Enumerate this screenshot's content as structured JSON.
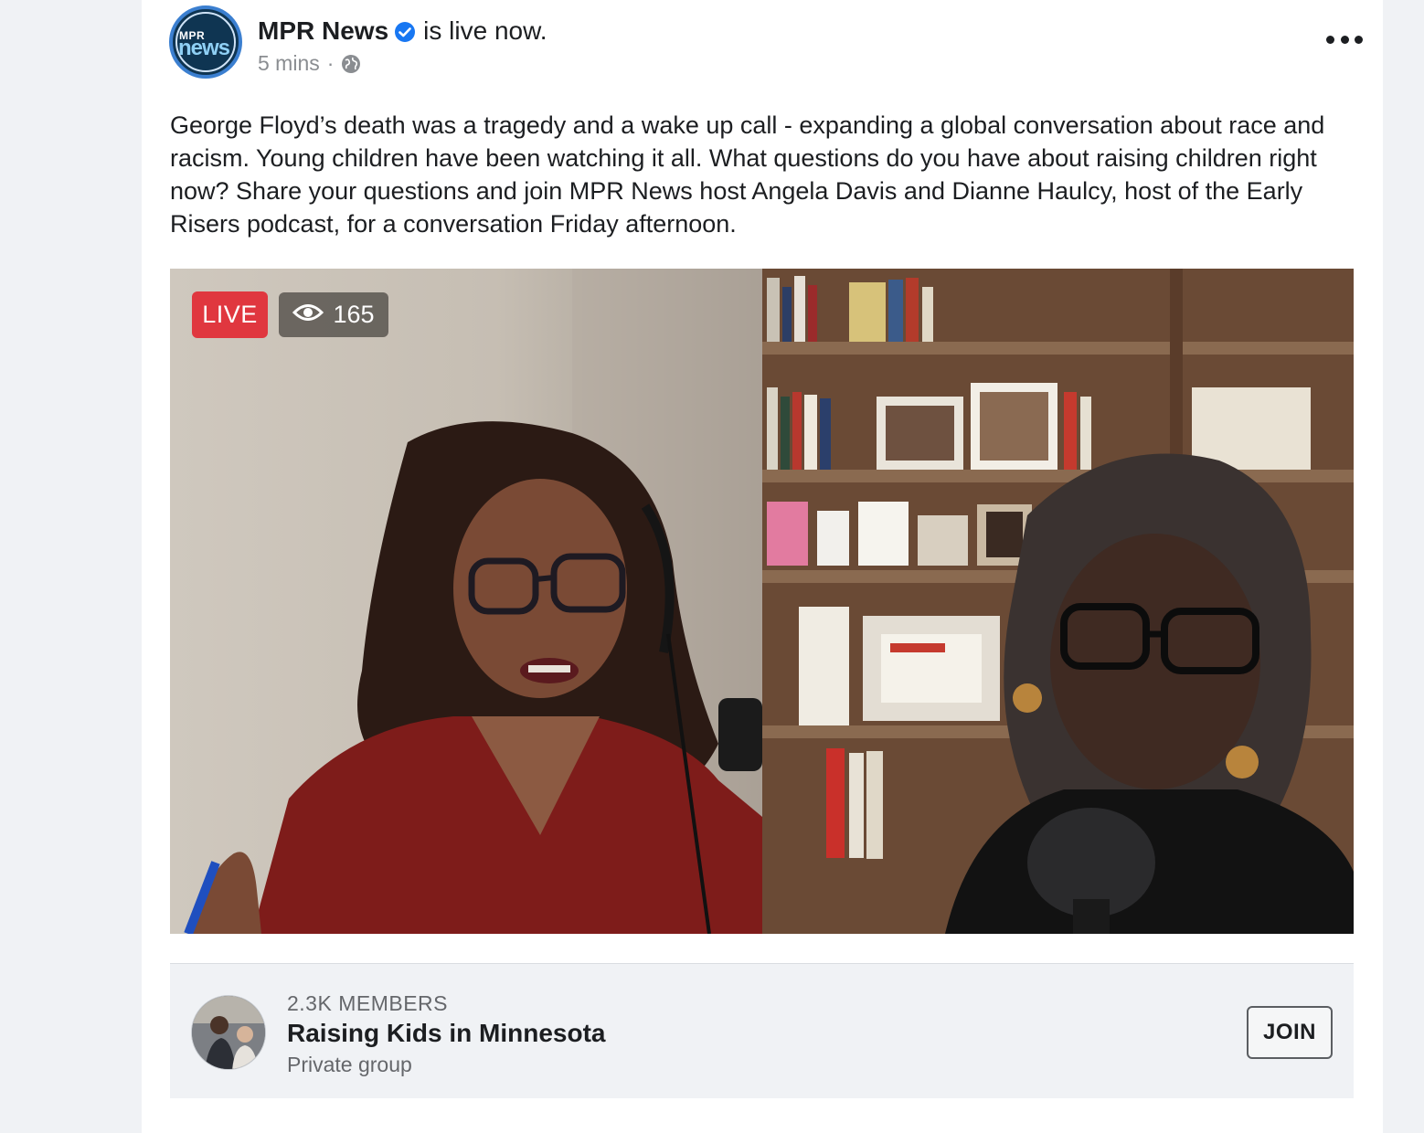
{
  "post": {
    "page_name": "MPR News",
    "status": "is live now.",
    "time": "5 mins",
    "separator": "·",
    "avatar": {
      "line1": "MPR",
      "line2": "news"
    },
    "text": "George Floyd’s death was a tragedy and a wake up call - expanding a global conversation about race and racism. Young children have been watching it all. What questions do you have about raising children right now? Share your questions and join MPR News host Angela Davis and Dianne Haulcy, host of the Early Risers podcast, for a conversation Friday afternoon."
  },
  "video": {
    "live_label": "LIVE",
    "viewer_count": "165",
    "colors": {
      "live": "#e0373f"
    }
  },
  "group": {
    "members": "2.3K MEMBERS",
    "name": "Raising Kids in Minnesota",
    "type": "Private group",
    "join_label": "JOIN"
  },
  "icons": [
    "verified-badge-icon",
    "globe-icon",
    "more-options-icon",
    "eye-icon"
  ],
  "colors": {
    "verified": "#1877f2",
    "background": "#f0f2f5"
  }
}
